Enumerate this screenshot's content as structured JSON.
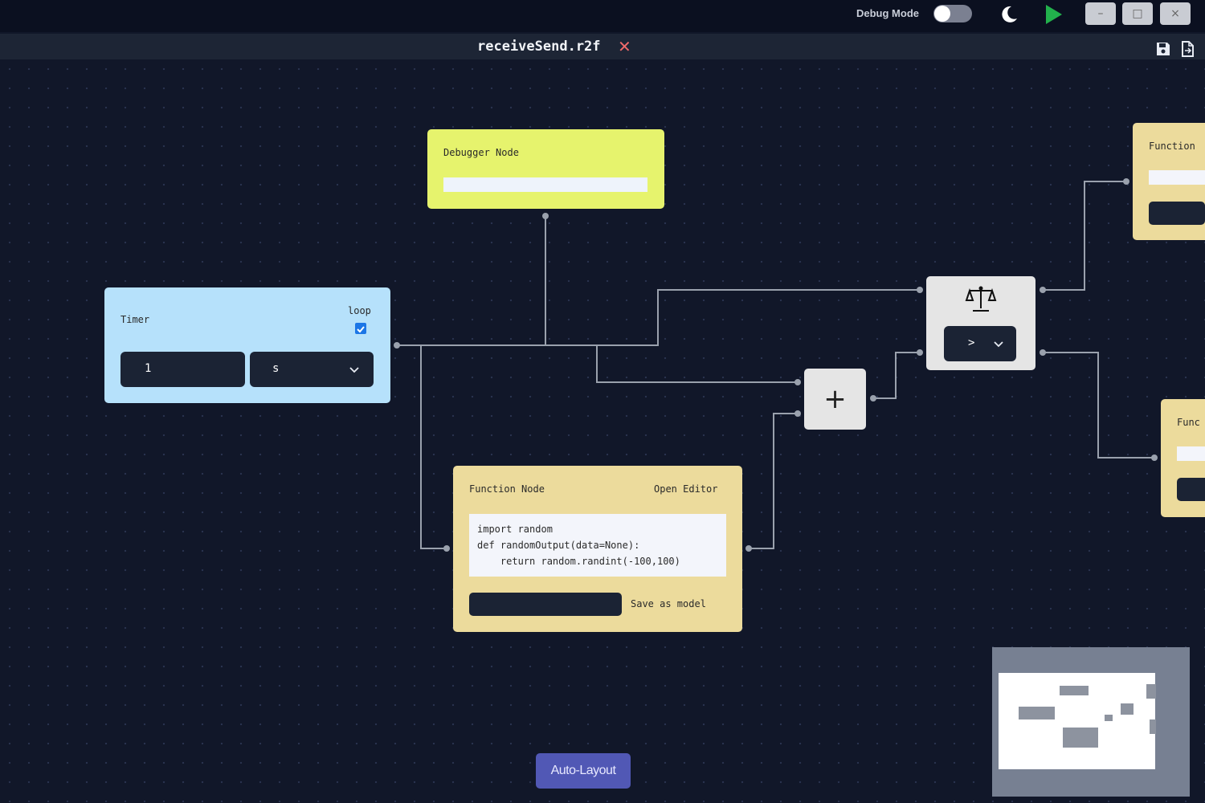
{
  "topbar": {
    "debug_mode_label": "Debug Mode",
    "debug_mode_on": false,
    "theme_icon": "moon-icon",
    "run_icon": "play-icon",
    "run_color": "#22b14c",
    "window_controls": {
      "minimize": "–",
      "maximize": "□",
      "close": "×"
    }
  },
  "tab": {
    "title": "receiveSend.r2f",
    "close": "✕",
    "close_color": "#f06a6a",
    "tools": [
      "save-icon",
      "export-file-icon"
    ]
  },
  "nodes": {
    "debugger": {
      "title": "Debugger Node",
      "color": "#e6f36d"
    },
    "timer": {
      "title": "Timer",
      "loop_label": "loop",
      "loop_checked": true,
      "value": "1",
      "unit": "s",
      "color": "#b6e1fb"
    },
    "function": {
      "title": "Function Node",
      "open_editor": "Open Editor",
      "code": "import random\ndef randomOutput(data=None):\n    return random.randint(-100,100)",
      "save_as_model": "Save as model",
      "color": "#ecdb9c"
    },
    "function_right_top": {
      "title": "Function"
    },
    "function_right_bottom": {
      "title": "Func"
    },
    "add": {
      "symbol": "+",
      "icon": "plus-icon"
    },
    "compare": {
      "icon": "scale-icon",
      "operator": ">"
    }
  },
  "buttons": {
    "auto_layout": "Auto-Layout",
    "auto_layout_color": "#5158b5"
  }
}
